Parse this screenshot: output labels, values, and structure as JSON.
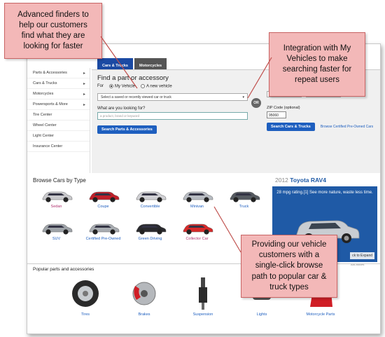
{
  "callouts": {
    "finders": "Advanced finders to help our customers find what they are looking for faster",
    "my_vehicles": "Integration with My Vehicles to make searching faster for repeat users",
    "browse_path": "Providing our vehicle customers with a single-click browse path to popular car & truck types"
  },
  "sidebar": {
    "items": [
      {
        "label": "Parts & Accessories"
      },
      {
        "label": "Cars & Trucks"
      },
      {
        "label": "Motorcycles"
      },
      {
        "label": "Powersports & More"
      },
      {
        "label": "Tire Center"
      },
      {
        "label": "Wheel Center"
      },
      {
        "label": "Light Center"
      },
      {
        "label": "Insurance Center"
      }
    ]
  },
  "tabs": {
    "cars_trucks": "Cars & Trucks",
    "motorcycles": "Motorcycles"
  },
  "finder": {
    "title": "Find a part or accessory",
    "for_label": "For",
    "my_vehicle": "My Vehicle",
    "new_vehicle": "A new vehicle",
    "select_placeholder": "Select a saved or recently viewed car or truck",
    "query_label": "What are you looking for?",
    "query_placeholder": "a product, brand or keyword",
    "search_button": "Search Parts & Accessories",
    "or_label": "OR",
    "make_select": "Any Make",
    "model_select": "Any Model",
    "zip_label": "ZIP Code (optional)",
    "zip_value": "95060",
    "search_cars_button": "Search Cars & Trucks",
    "browse_certified": "Browse Certified Pre-Owned Cars"
  },
  "browse": {
    "title": "Browse Cars by Type",
    "types": [
      {
        "label": "Sedan",
        "color": "#b0306e",
        "car_color": "#c9c9cc"
      },
      {
        "label": "Coupe",
        "color": "#1e5fbf",
        "car_color": "#c0202a"
      },
      {
        "label": "Convertible",
        "color": "#1e5fbf",
        "car_color": "#d0d0d4"
      },
      {
        "label": "Minivan",
        "color": "#1e5fbf",
        "car_color": "#b8bcc2"
      },
      {
        "label": "Truck",
        "color": "#1e5fbf",
        "car_color": "#555a60"
      },
      {
        "label": "SUV",
        "color": "#1e5fbf",
        "car_color": "#9ea3a8"
      },
      {
        "label": "Certified Pre-Owned",
        "color": "#1e5fbf",
        "car_color": "#a8acb1"
      },
      {
        "label": "Green Driving",
        "color": "#1e5fbf",
        "car_color": "#2a2a2e"
      },
      {
        "label": "Collector Car",
        "color": "#b0306e",
        "car_color": "#d62a2a"
      }
    ]
  },
  "ad": {
    "year": "2012",
    "model": "Toyota RAV4",
    "text": "28 mpg rating.[1] See more nature, waste less time.",
    "expand": "ck to Expand",
    "adchoices": "AdChoices"
  },
  "parts": {
    "title": "Popular parts and accessories",
    "items": [
      {
        "label": "Tires"
      },
      {
        "label": "Brakes"
      },
      {
        "label": "Suspension"
      },
      {
        "label": "Lights"
      },
      {
        "label": "Motorcycle Parts"
      }
    ]
  }
}
